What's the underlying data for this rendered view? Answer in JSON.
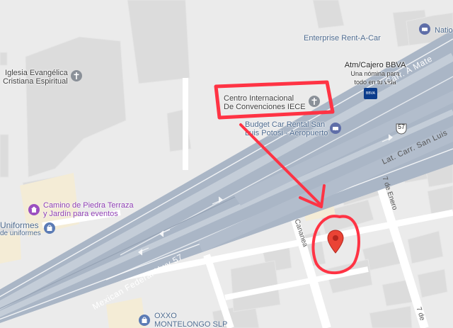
{
  "places": {
    "enterprise": "Enterprise Rent-A-Car",
    "national": "Natio",
    "atm_title": "Atm/Cajero BBVA",
    "atm_line1": "Una nómina para",
    "atm_line2": "todo en tu vida",
    "bbva_logo": "BBVA",
    "iglesia_line1": "Iglesia Evangélica",
    "iglesia_line2": "Cristiana Espiritual",
    "centro_line1": "Centro Internacional",
    "centro_line2": "De Convenciones IECE",
    "budget_line1": "Budget Car Rental San",
    "budget_line2": "Luis Potosi - Aeropuerto",
    "camino_line1": "Camino de Piedra Terraza",
    "camino_line2": "y Jardín para eventos",
    "uniformes_line1": "Uniformes",
    "uniformes_line2": "de uniformes",
    "oxxo_line1": "OXXO",
    "oxxo_line2": "MONTELONGO SLP"
  },
  "roads": {
    "carr_a_mate": "Carr. A Mate",
    "lat_carr": "Lat. Carr. San Luis",
    "mexican_hwy": "Mexican Federal Hwy 57",
    "shield": "57",
    "cananea": "Cananea",
    "enero_7a": "7 de Enero",
    "enero_7b": "7 de"
  },
  "colors": {
    "background": "#ebebeb",
    "building": "#dcdcdc",
    "highway": "#aab6c6",
    "annotation": "#ff3344",
    "pin": "#ea4335"
  }
}
